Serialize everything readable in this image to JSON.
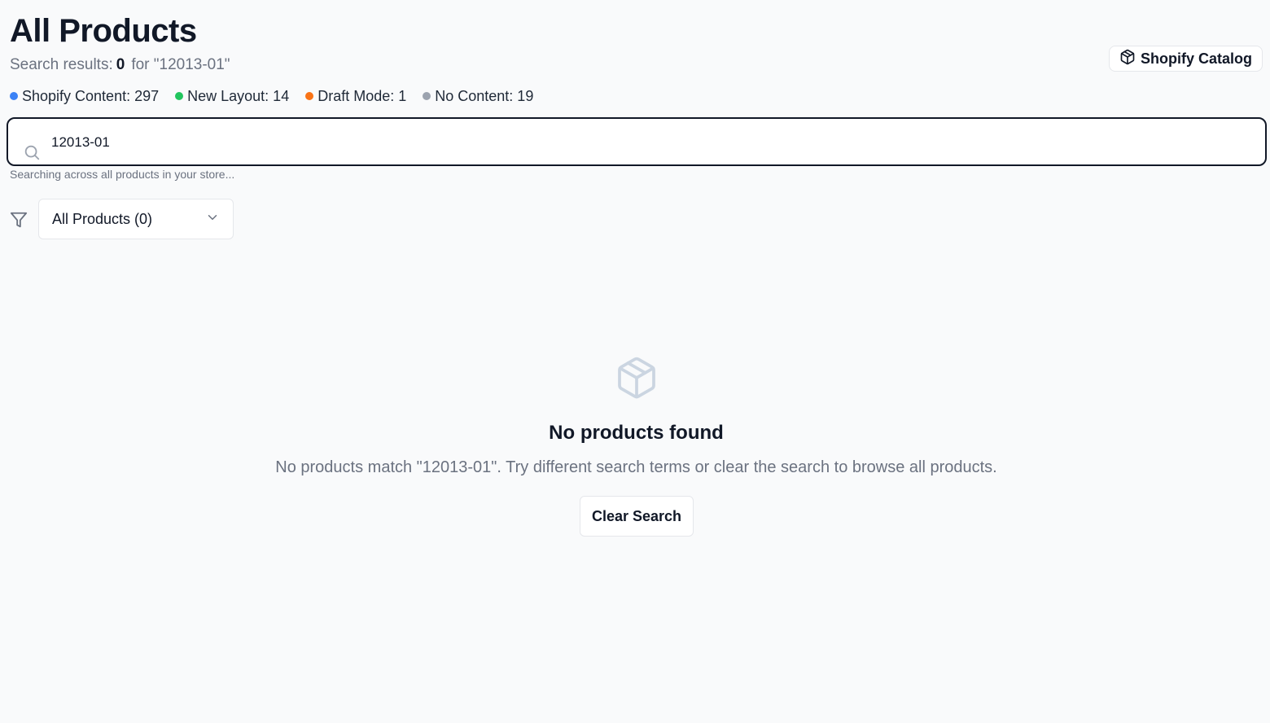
{
  "header": {
    "title": "All Products",
    "results_prefix": "Search results:",
    "results_count": "0",
    "results_query": "for \"12013-01\"",
    "catalog_button": "Shopify Catalog"
  },
  "stats": [
    {
      "label": "Shopify Content: 297",
      "color": "#3b82f6"
    },
    {
      "label": "New Layout: 14",
      "color": "#22c55e"
    },
    {
      "label": "Draft Mode: 1",
      "color": "#f97316"
    },
    {
      "label": "No Content: 19",
      "color": "#9ca3af"
    }
  ],
  "search": {
    "value": "12013-01",
    "helper": "Searching across all products in your store..."
  },
  "filter": {
    "selected": "All Products (0)"
  },
  "empty_state": {
    "title": "No products found",
    "description": "No products match \"12013-01\". Try different search terms or clear the search to browse all products.",
    "button": "Clear Search"
  },
  "colors": {
    "text": "#111827",
    "muted": "#6b7280",
    "icon_muted": "#cbd5e1"
  }
}
